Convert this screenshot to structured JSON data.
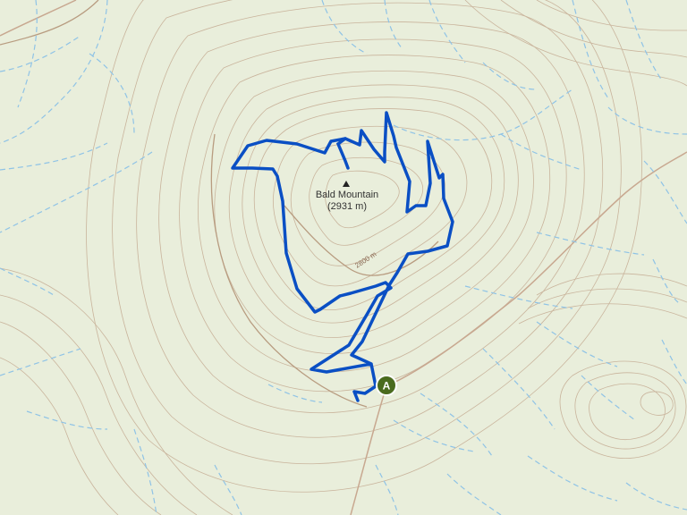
{
  "map": {
    "peak": {
      "name": "Bald Mountain",
      "elevation": "(2931 m)"
    },
    "contour_label": "2800 m",
    "start_marker": {
      "letter": "A",
      "color": "#4a6b1e"
    },
    "colors": {
      "background": "#e9eedb",
      "contour": "#c9b49c",
      "contour_index": "#b89c80",
      "stream": "#8fc3e6",
      "trail": "#0a4fc4",
      "road": "#c8a890"
    }
  }
}
